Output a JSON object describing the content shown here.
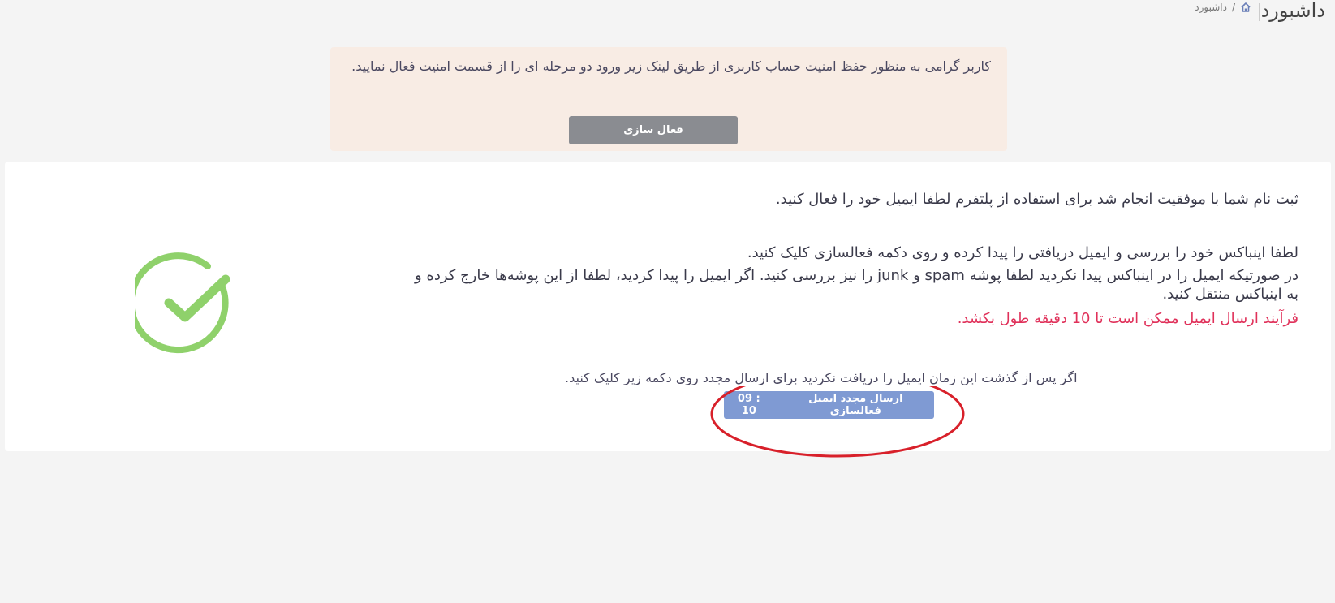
{
  "header": {
    "title": "داشبورد",
    "breadcrumb": {
      "current": "داشبورد",
      "separator": "/"
    }
  },
  "security_alert": {
    "message": "کاربر گرامی به منظور حفظ امنیت حساب کاربری از طریق لینک زیر ورود دو مرحله ای را از قسمت امنیت فعال نمایید.",
    "button_label": "فعال سازی"
  },
  "registration_card": {
    "line1": "ثبت نام شما با موفقیت انجام شد برای استفاده از پلتفرم لطفا ایمیل خود را فعال کنید.",
    "line2": "لطفا اینباکس خود را بررسی و ایمیل دریافتی را پیدا کرده و روی دکمه فعالسازی کلیک کنید.",
    "line3": "در صورتیکه ایمیل را در اینباکس پیدا نکردید لطفا پوشه spam و junk را نیز بررسی کنید. اگر ایمیل را پیدا کردید، لطفا از این پوشه‌ها خارج کرده و",
    "line4": "به اینباکس منتقل کنید.",
    "warning": "فرآیند ارسال ایمیل ممکن است تا 10 دقیقه طول بکشد.",
    "resend_note": "اگر پس از گذشت این زمان ایمیل را دریافت نکردید برای ارسال مجدد روی دکمه زیر کلیک کنید.",
    "resend_button_label": "ارسال مجدد ایمیل فعالسازی",
    "resend_timer": "09 : 10"
  },
  "colors": {
    "success_icon": "#8fd16b",
    "warning_text": "#e0315a",
    "resend_button": "#7f9ad3",
    "activate_button": "#8a8c91",
    "alert_background": "#f8ece4",
    "annotation_ellipse": "#d8202a"
  },
  "icons": {
    "breadcrumb_home": "home-icon",
    "status": "check-circle-icon"
  }
}
